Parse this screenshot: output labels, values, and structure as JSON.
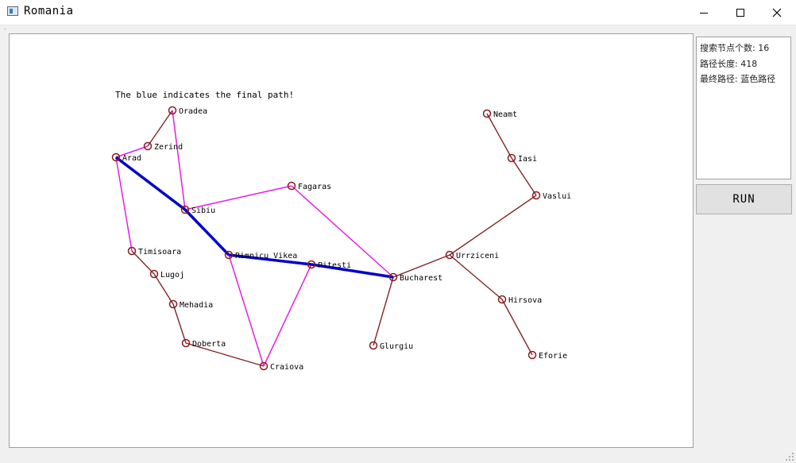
{
  "window": {
    "title": "Romania",
    "minimize_icon": "minimize-icon",
    "maximize_icon": "maximize-icon",
    "close_icon": "close-icon"
  },
  "map": {
    "caption": "The blue indicates the final path!",
    "colors": {
      "edge": "#7f2626",
      "explored_edge": "#e61ee6",
      "final_path": "#0000c8",
      "node": "#8b1a1a"
    },
    "cities": [
      {
        "id": "oradea",
        "name": "Oradea"
      },
      {
        "id": "zerind",
        "name": "Zerind"
      },
      {
        "id": "arad",
        "name": "Arad"
      },
      {
        "id": "sibiu",
        "name": "Sibiu"
      },
      {
        "id": "fagaras",
        "name": "Fagaras"
      },
      {
        "id": "timisoara",
        "name": "Timisoara"
      },
      {
        "id": "lugoj",
        "name": "Lugoj"
      },
      {
        "id": "mehadia",
        "name": "Mehadia"
      },
      {
        "id": "doberta",
        "name": "Doberta"
      },
      {
        "id": "craiova",
        "name": "Craiova"
      },
      {
        "id": "rimnicu",
        "name": "Rimnicu Vikea"
      },
      {
        "id": "pitesti",
        "name": "Pitesti"
      },
      {
        "id": "bucharest",
        "name": "Bucharest"
      },
      {
        "id": "glurgiu",
        "name": "Glurgiu"
      },
      {
        "id": "urrziceni",
        "name": "Urrziceni"
      },
      {
        "id": "hirsova",
        "name": "Hirsova"
      },
      {
        "id": "eforie",
        "name": "Eforie"
      },
      {
        "id": "vaslui",
        "name": "Vaslui"
      },
      {
        "id": "iasi",
        "name": "Iasi"
      },
      {
        "id": "neamt",
        "name": "Neamt"
      }
    ],
    "edges": [
      {
        "from": "oradea",
        "to": "zerind",
        "state": "normal"
      },
      {
        "from": "timisoara",
        "to": "lugoj",
        "state": "normal"
      },
      {
        "from": "lugoj",
        "to": "mehadia",
        "state": "normal"
      },
      {
        "from": "mehadia",
        "to": "doberta",
        "state": "normal"
      },
      {
        "from": "doberta",
        "to": "craiova",
        "state": "normal"
      },
      {
        "from": "bucharest",
        "to": "glurgiu",
        "state": "normal"
      },
      {
        "from": "bucharest",
        "to": "urrziceni",
        "state": "normal"
      },
      {
        "from": "urrziceni",
        "to": "vaslui",
        "state": "normal"
      },
      {
        "from": "urrziceni",
        "to": "hirsova",
        "state": "normal"
      },
      {
        "from": "hirsova",
        "to": "eforie",
        "state": "normal"
      },
      {
        "from": "vaslui",
        "to": "iasi",
        "state": "normal"
      },
      {
        "from": "iasi",
        "to": "neamt",
        "state": "normal"
      },
      {
        "from": "arad",
        "to": "zerind",
        "state": "explored"
      },
      {
        "from": "arad",
        "to": "timisoara",
        "state": "explored"
      },
      {
        "from": "oradea",
        "to": "sibiu",
        "state": "explored"
      },
      {
        "from": "sibiu",
        "to": "fagaras",
        "state": "explored"
      },
      {
        "from": "fagaras",
        "to": "bucharest",
        "state": "explored"
      },
      {
        "from": "rimnicu",
        "to": "craiova",
        "state": "explored"
      },
      {
        "from": "pitesti",
        "to": "craiova",
        "state": "explored"
      },
      {
        "from": "arad",
        "to": "sibiu",
        "state": "final"
      },
      {
        "from": "sibiu",
        "to": "rimnicu",
        "state": "final"
      },
      {
        "from": "rimnicu",
        "to": "pitesti",
        "state": "final"
      },
      {
        "from": "pitesti",
        "to": "bucharest",
        "state": "final"
      }
    ]
  },
  "info": {
    "nodes_searched": "搜索节点个数: 16",
    "path_length": "路径长度: 418",
    "final_path": "最终路径: 蓝色路径"
  },
  "run_button": {
    "label": "RUN"
  }
}
